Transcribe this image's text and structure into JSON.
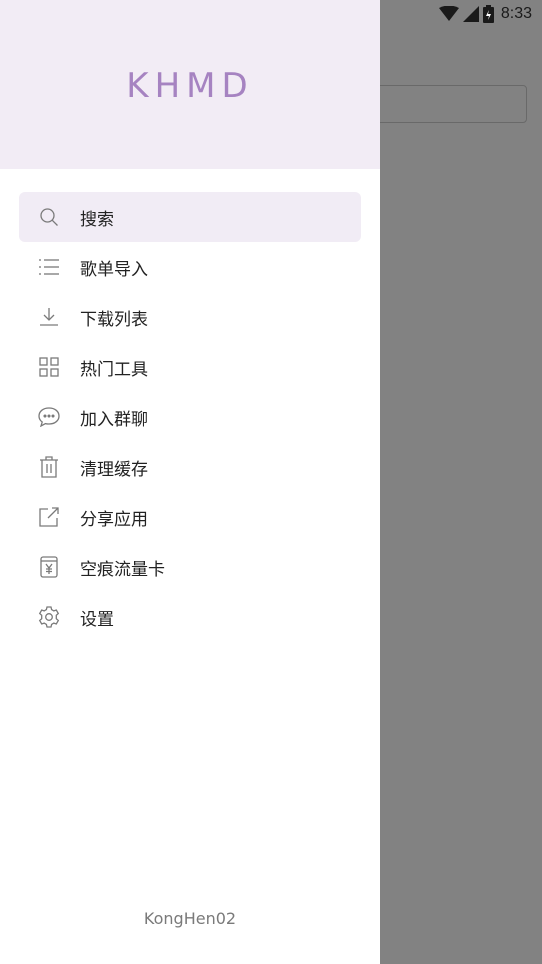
{
  "status_bar": {
    "time": "8:33",
    "icons": [
      "wifi-icon",
      "signal-icon",
      "battery-icon"
    ]
  },
  "drawer": {
    "title": "KHMD",
    "items": [
      {
        "label": "搜索",
        "icon": "search-icon",
        "active": true
      },
      {
        "label": "歌单导入",
        "icon": "list-icon"
      },
      {
        "label": "下载列表",
        "icon": "download-icon"
      },
      {
        "label": "热门工具",
        "icon": "grid-icon"
      },
      {
        "label": "加入群聊",
        "icon": "chat-icon"
      },
      {
        "label": "清理缓存",
        "icon": "trash-icon"
      },
      {
        "label": "分享应用",
        "icon": "share-icon"
      },
      {
        "label": "空痕流量卡",
        "icon": "sim-card-icon"
      },
      {
        "label": "设置",
        "icon": "gear-icon"
      }
    ],
    "footer": "KongHen02"
  },
  "colors": {
    "accent": "#a683c1",
    "header_bg": "#f2ecf5",
    "active_bg": "#f1ecf5",
    "scrim": "#808080"
  }
}
